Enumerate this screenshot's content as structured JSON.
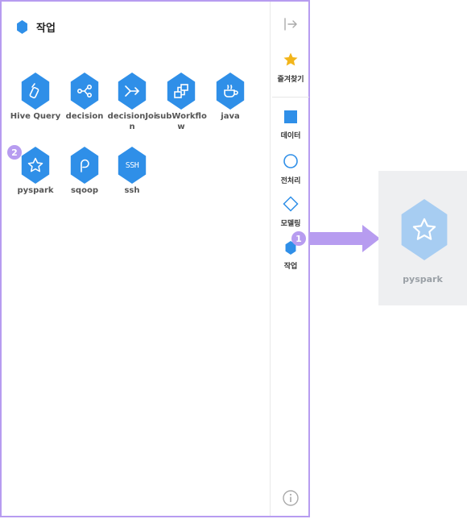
{
  "header": {
    "title": "작업",
    "icon": "hexagon-icon"
  },
  "tiles": [
    {
      "label": "Hive Query",
      "icon": "hive-icon"
    },
    {
      "label": "decision",
      "icon": "decision-icon"
    },
    {
      "label": "decisionJoin",
      "icon": "decision-join-icon"
    },
    {
      "label": "subWorkflow",
      "icon": "sub-workflow-icon"
    },
    {
      "label": "java",
      "icon": "java-icon"
    },
    {
      "label": "pyspark",
      "icon": "star-icon"
    },
    {
      "label": "sqoop",
      "icon": "sqoop-icon"
    },
    {
      "label": "ssh",
      "icon": "ssh-icon",
      "icon_text": "SSH"
    }
  ],
  "rail": {
    "collapse_icon": "collapse-arrow-icon",
    "items": [
      {
        "label": "즐겨찾기",
        "icon": "star-icon"
      },
      {
        "label": "데이터",
        "icon": "square-icon"
      },
      {
        "label": "전처리",
        "icon": "circle-icon"
      },
      {
        "label": "모델링",
        "icon": "diamond-icon"
      },
      {
        "label": "작업",
        "icon": "hexagon-icon"
      }
    ],
    "info_icon": "info-icon"
  },
  "annotations": {
    "badge1": "1",
    "badge2": "2"
  },
  "preview": {
    "label": "pyspark",
    "icon": "star-icon"
  },
  "colors": {
    "accent": "#2f8fe8",
    "annotation": "#b79cf0",
    "star": "#f2b51b"
  }
}
